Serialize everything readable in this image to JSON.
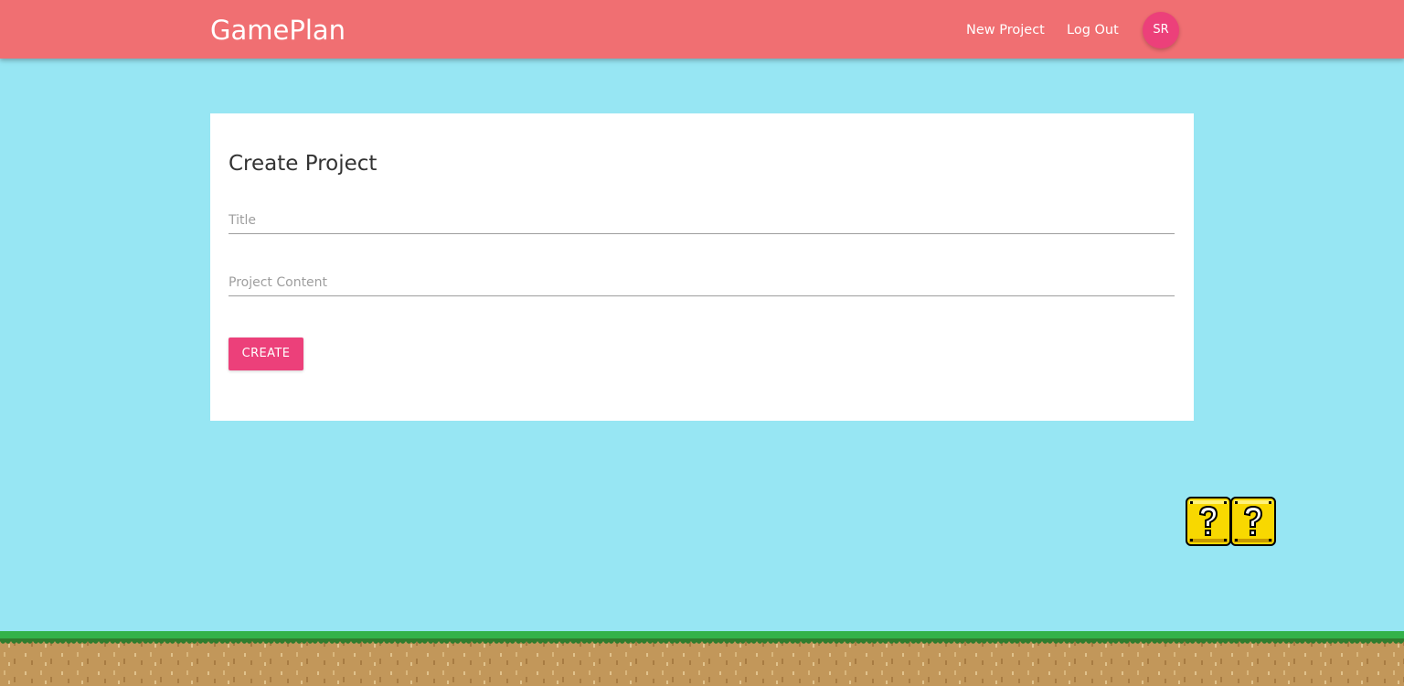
{
  "header": {
    "brand": "GamePlan",
    "nav": {
      "new_project": "New Project",
      "log_out": "Log Out"
    },
    "avatar_initials": "SR"
  },
  "form": {
    "heading": "Create Project",
    "title_placeholder": "Title",
    "content_placeholder": "Project Content",
    "submit_label": "CREATE"
  },
  "decor": {
    "question_blocks": [
      "question-block-icon",
      "question-block-icon"
    ],
    "ground": "grass-ground"
  },
  "colors": {
    "navbar": "#f06f72",
    "background": "#97e6f3",
    "accent": "#ec407a",
    "card": "#ffffff"
  }
}
